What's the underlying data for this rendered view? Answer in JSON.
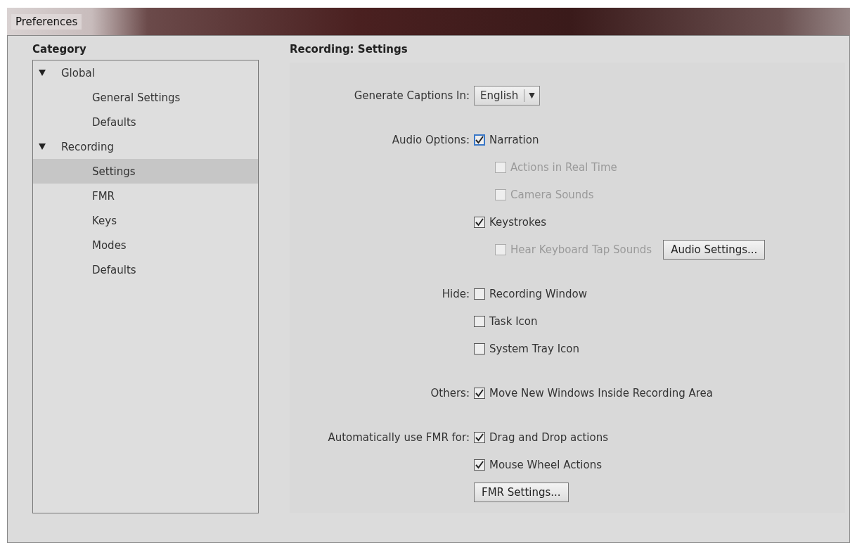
{
  "window": {
    "title": "Preferences"
  },
  "category": {
    "heading": "Category",
    "tree": [
      {
        "label": "Global",
        "expanded": true,
        "selected": false,
        "children": [
          {
            "label": "General Settings",
            "selected": false
          },
          {
            "label": "Defaults",
            "selected": false
          }
        ]
      },
      {
        "label": "Recording",
        "expanded": true,
        "selected": false,
        "children": [
          {
            "label": "Settings",
            "selected": true
          },
          {
            "label": "FMR",
            "selected": false
          },
          {
            "label": "Keys",
            "selected": false
          },
          {
            "label": "Modes",
            "selected": false
          },
          {
            "label": "Defaults",
            "selected": false
          }
        ]
      }
    ]
  },
  "settings": {
    "heading": "Recording: Settings",
    "captions": {
      "label": "Generate Captions In:",
      "value": "English",
      "arrow": "▼"
    },
    "groups": [
      {
        "label": "Audio Options:",
        "items": [
          {
            "label": "Narration",
            "checked": true,
            "disabled": false,
            "focused": true,
            "children": [
              {
                "label": "Actions in Real Time",
                "checked": false,
                "disabled": true
              },
              {
                "label": "Camera Sounds",
                "checked": false,
                "disabled": true
              }
            ]
          },
          {
            "label": "Keystrokes",
            "checked": true,
            "disabled": false,
            "children": [
              {
                "label": "Hear Keyboard Tap Sounds",
                "checked": false,
                "disabled": true,
                "button": "Audio Settings..."
              }
            ]
          }
        ]
      },
      {
        "label": "Hide:",
        "items": [
          {
            "label": "Recording Window",
            "checked": false,
            "disabled": false
          },
          {
            "label": "Task Icon",
            "checked": false,
            "disabled": false
          },
          {
            "label": "System Tray Icon",
            "checked": false,
            "disabled": false
          }
        ]
      },
      {
        "label": "Others:",
        "items": [
          {
            "label": "Move New Windows Inside Recording Area",
            "checked": true,
            "disabled": false
          }
        ]
      },
      {
        "label": "Automatically use FMR for:",
        "items": [
          {
            "label": "Drag and Drop actions",
            "checked": true,
            "disabled": false
          },
          {
            "label": "Mouse Wheel Actions",
            "checked": true,
            "disabled": false
          }
        ],
        "button": "FMR Settings..."
      }
    ]
  }
}
